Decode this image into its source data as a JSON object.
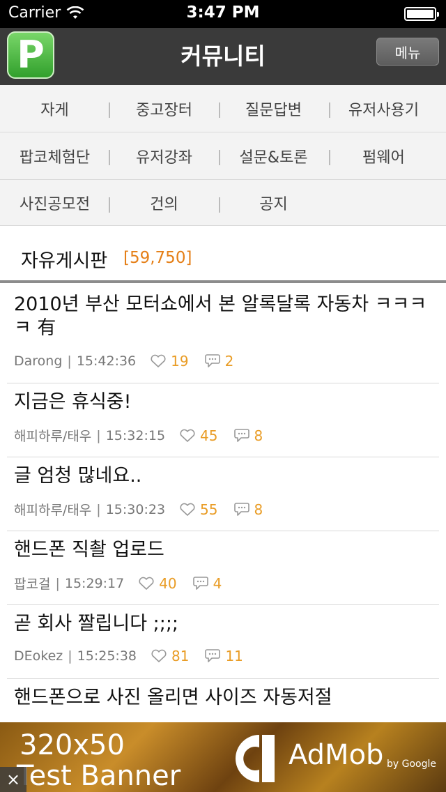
{
  "status_bar": {
    "carrier": "Carrier",
    "time": "3:47 PM"
  },
  "nav": {
    "logo_letter": "P",
    "title": "커뮤니티",
    "menu_label": "메뉴"
  },
  "categories": [
    [
      "자게",
      "중고장터",
      "질문답변",
      "유저사용기"
    ],
    [
      "팝코체험단",
      "유저강좌",
      "설문&토론",
      "펌웨어"
    ],
    [
      "사진공모전",
      "건의",
      "공지"
    ]
  ],
  "board": {
    "title": "자유게시판",
    "count": "[59,750]"
  },
  "posts": [
    {
      "title": "2010년 부산 모터쇼에서 본 알록달록 자동차 ㅋㅋㅋㅋ 有",
      "author": "Darong",
      "time": "15:42:36",
      "likes": "19",
      "comments": "2"
    },
    {
      "title": "지금은 휴식중!",
      "author": "해피하루/태우",
      "time": "15:32:15",
      "likes": "45",
      "comments": "8"
    },
    {
      "title": "글 엄청 많네요..",
      "author": "해피하루/태우",
      "time": "15:30:23",
      "likes": "55",
      "comments": "8"
    },
    {
      "title": "핸드폰 직촬 업로드",
      "author": "팝코걸",
      "time": "15:29:17",
      "likes": "40",
      "comments": "4"
    },
    {
      "title": "곧 회사 짤립니다 ;;;;",
      "author": "DEokez",
      "time": "15:25:38",
      "likes": "81",
      "comments": "11"
    },
    {
      "title": "핸드폰으로 사진 올리면 사이즈 자동저절"
    }
  ],
  "ad": {
    "size_text": "320x50",
    "test_text": "Test Banner",
    "brand": "AdMob",
    "by": "by Google",
    "close": "×"
  },
  "colors": {
    "accent_orange": "#e57f17",
    "nav_background": "#3a3a3a",
    "logo_green": "#2f9e2a"
  }
}
